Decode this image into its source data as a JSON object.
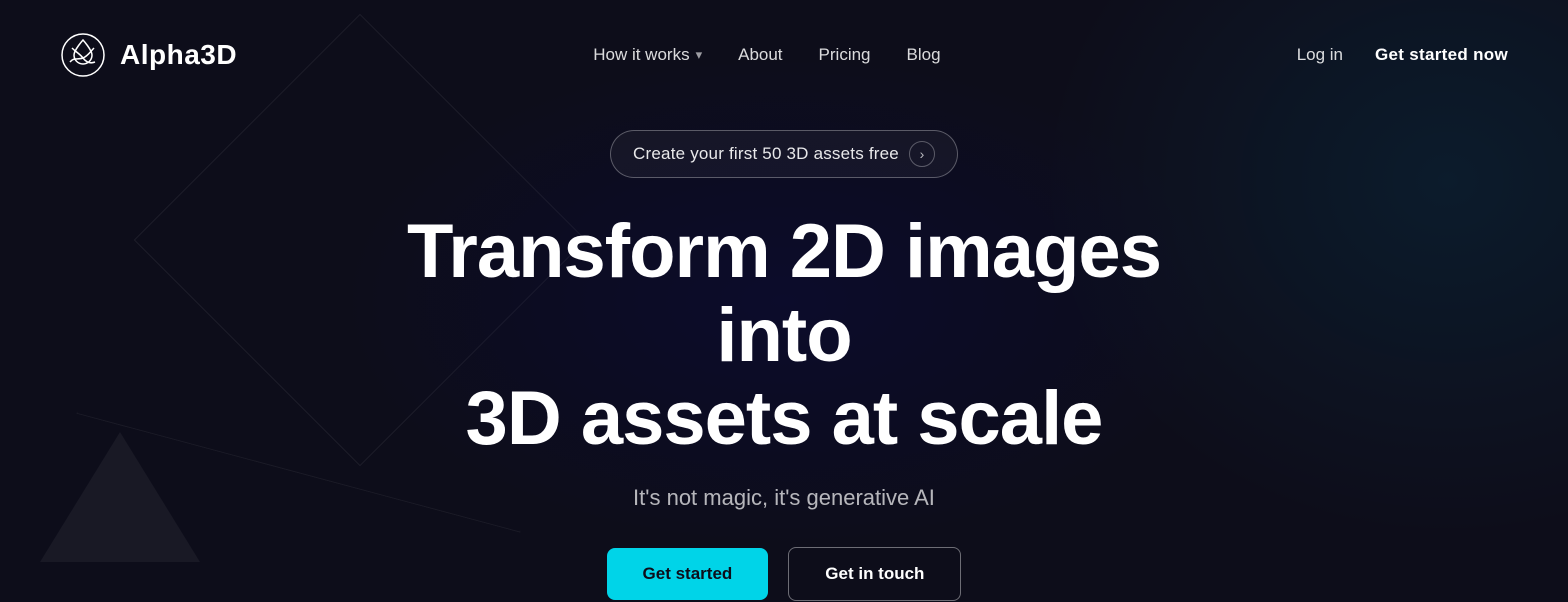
{
  "brand": {
    "name": "Alpha3D",
    "logo_alt": "Alpha3D logo"
  },
  "nav": {
    "links": [
      {
        "id": "how-it-works",
        "label": "How it works",
        "has_dropdown": true
      },
      {
        "id": "about",
        "label": "About",
        "has_dropdown": false
      },
      {
        "id": "pricing",
        "label": "Pricing",
        "has_dropdown": false
      },
      {
        "id": "blog",
        "label": "Blog",
        "has_dropdown": false
      }
    ],
    "login_label": "Log in",
    "cta_label": "Get started now"
  },
  "hero": {
    "badge_text": "Create your first 50 3D assets free",
    "badge_arrow": "›",
    "title_line1": "Transform 2D images into",
    "title_line2": "3D assets at scale",
    "subtitle": "It's not magic, it's generative AI",
    "btn_primary": "Get started",
    "btn_secondary": "Get in touch"
  },
  "colors": {
    "bg": "#0d0d1a",
    "accent_cyan": "#00d4e8",
    "text_primary": "#ffffff",
    "text_muted": "rgba(255,255,255,0.7)"
  }
}
